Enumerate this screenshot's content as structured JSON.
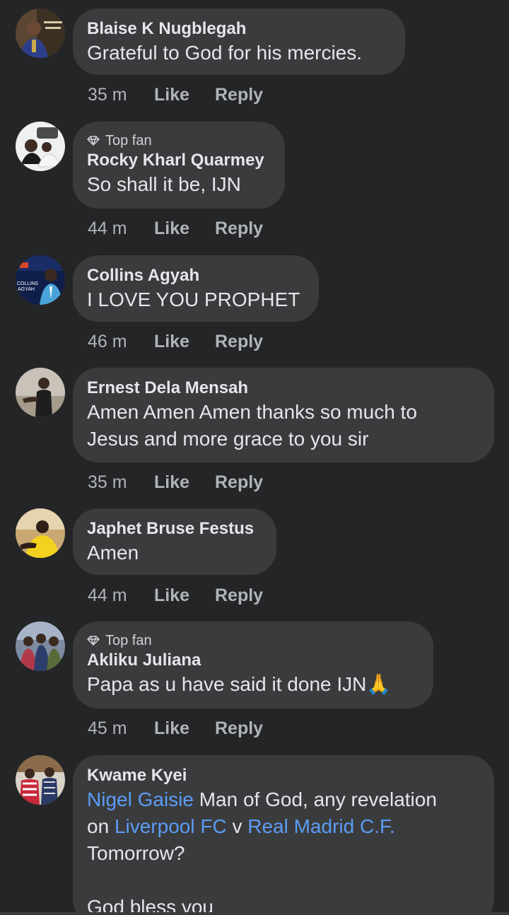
{
  "comments": [
    {
      "author": "Blaise K Nugblegah",
      "badge": "",
      "text": "Grateful to God for his mercies.",
      "time": "35 m",
      "like_label": "Like",
      "reply_label": "Reply"
    },
    {
      "author": "Rocky Kharl Quarmey",
      "badge": "Top fan",
      "text": "So shall it be, IJN",
      "time": "44 m",
      "like_label": "Like",
      "reply_label": "Reply"
    },
    {
      "author": "Collins Agyah",
      "badge": "",
      "text": "I LOVE YOU PROPHET",
      "time": "46 m",
      "like_label": "Like",
      "reply_label": "Reply"
    },
    {
      "author": "Ernest Dela Mensah",
      "badge": "",
      "text_line1": "Amen Amen Amen thanks so much to",
      "text_line2": "Jesus and more grace to you sir",
      "time": "35 m",
      "like_label": "Like",
      "reply_label": "Reply"
    },
    {
      "author": "Japhet Bruse Festus",
      "badge": "",
      "text": "Amen",
      "time": "44 m",
      "like_label": "Like",
      "reply_label": "Reply"
    },
    {
      "author": "Akliku Juliana",
      "badge": "Top fan",
      "text": "Papa as u have said it done IJN",
      "emoji": "🙏",
      "time": "45 m",
      "like_label": "Like",
      "reply_label": "Reply"
    },
    {
      "author": "Kwame Kyei",
      "badge": "",
      "mention1": "Nigel Gaisie",
      "text_part1": " Man of God, any revelation",
      "text_part2": "on ",
      "mention2": "Liverpool FC",
      "text_part3": " v ",
      "mention3": "Real Madrid C.F.",
      "text_part4": "Tomorrow?",
      "text_part5": "God bless you"
    }
  ],
  "avatar_text": {
    "collins": [
      "COLLINS",
      "AGYAH"
    ]
  },
  "colors": {
    "background": "#242526",
    "bubble": "#3a3b3c",
    "text": "#e4e6eb",
    "secondary": "#b0b3b8",
    "mention": "#5b9cf5"
  },
  "icons": {
    "top_fan_badge": "diamond-icon"
  }
}
